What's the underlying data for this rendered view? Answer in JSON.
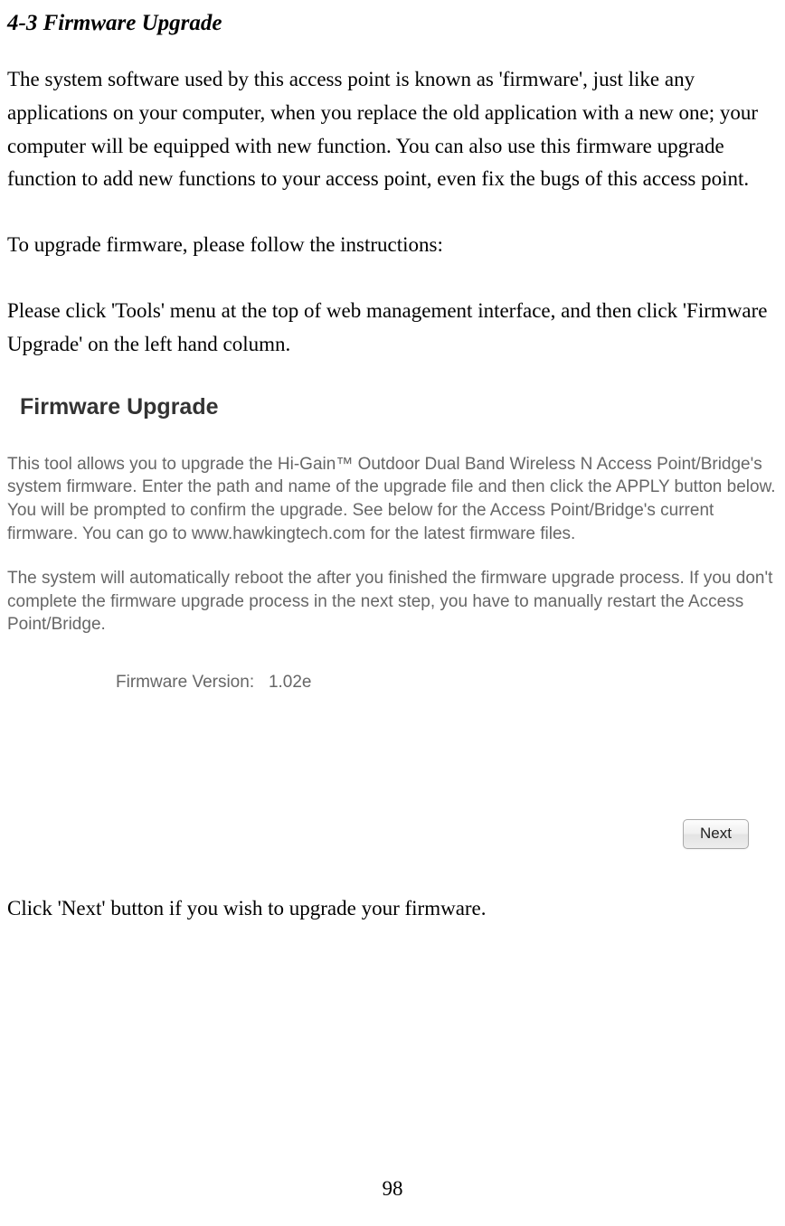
{
  "heading": "4-3 Firmware Upgrade",
  "para1": "The system software used by this access point is known as 'firmware', just like any applications on your computer, when you replace the old application with a new one; your computer will be equipped with new function. You can also use this firmware upgrade function to add new functions to your access point, even fix the bugs of this access point.",
  "para2": "To upgrade firmware, please follow the instructions:",
  "para3": "Please click 'Tools' menu at the top of web management interface, and then click 'Firmware Upgrade' on the left hand column.",
  "screenshot": {
    "title": "Firmware Upgrade",
    "body1": "This tool allows you to upgrade the Hi-Gain™ Outdoor Dual Band Wireless N Access Point/Bridge's system firmware. Enter the path and name of the upgrade file and then click the APPLY button below. You will be prompted to confirm the upgrade. See below for the Access Point/Bridge's current firmware. You can go to www.hawkingtech.com for the latest firmware files.",
    "body2": "The system will automatically reboot the after you finished the firmware upgrade process. If you don't complete the firmware upgrade process in the next step, you have to manually restart the Access Point/Bridge.",
    "firmware_label": "Firmware Version:",
    "firmware_value": "1.02e",
    "next_btn": "Next"
  },
  "para4": "Click 'Next' button if you wish to upgrade your firmware.",
  "page_number": "98"
}
